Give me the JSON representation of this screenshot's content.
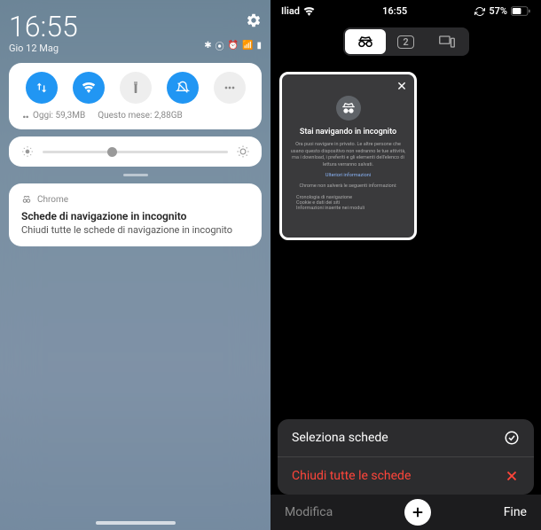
{
  "left": {
    "clock": "16:55",
    "date": "Gio 12 Mag",
    "stats_today_label": "Oggi: 59,3MB",
    "stats_month_label": "Questo mese: 2,88GB",
    "notif": {
      "app": "Chrome",
      "title": "Schede di navigazione in incognito",
      "body": "Chiudi tutte le schede di navigazione in incognito"
    }
  },
  "right": {
    "carrier": "Iliad",
    "clock": "16:55",
    "battery": "57%",
    "tab_count": "2",
    "incognito": {
      "title": "Stai navigando in incognito",
      "text1": "Ora puoi navigare in privato. Le altre persone che usano questo dispositivo non vedranno le tue attività, ma i download, i preferiti e gli elementi dell'elenco di lettura verranno salvati.",
      "link": "Ulteriori informazioni",
      "text2": "Chrome non salverà le seguenti informazioni:",
      "bullet1": "Cronologia di navigazione",
      "bullet2": "Cookie e dati dei siti",
      "bullet3": "Informazioni inserite nei moduli"
    },
    "menu": {
      "select": "Seleziona schede",
      "close_all": "Chiudi tutte le schede"
    },
    "toolbar": {
      "edit": "Modifica",
      "done": "Fine"
    }
  }
}
